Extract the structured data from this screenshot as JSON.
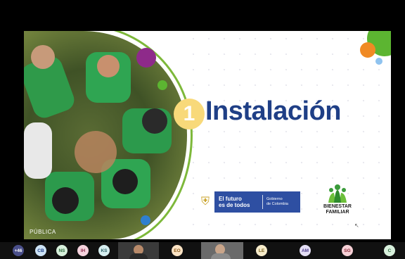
{
  "slide": {
    "number": "1",
    "title": "Instalación",
    "classification": "PÚBLICA",
    "gov_logo": {
      "main_line1": "El futuro",
      "main_line2": "es de todos",
      "sub_line1": "Gobierno",
      "sub_line2": "de Colombia"
    },
    "bf_logo": {
      "line1": "BIENESTAR",
      "line2": "FAMILIAR"
    }
  },
  "participants": [
    {
      "initials": "+46",
      "color": "#4a4f8a",
      "text_color": "#ffffff"
    },
    {
      "initials": "CB",
      "color": "#cde3f6",
      "text_color": "#1f3f86"
    },
    {
      "initials": "NS",
      "color": "#d8f0dc",
      "text_color": "#2d6a3e"
    },
    {
      "initials": "IH",
      "color": "#f6d3de",
      "text_color": "#8a2a4a"
    },
    {
      "initials": "KS",
      "color": "#d6eef0",
      "text_color": "#2b5f66"
    },
    {
      "initials": "EO",
      "color": "#fbe3c4",
      "text_color": "#8a5a1a"
    },
    {
      "initials": "LE",
      "color": "#f7eccb",
      "text_color": "#7a6220"
    },
    {
      "initials": "AM",
      "color": "#e4def4",
      "text_color": "#4a3a8a"
    },
    {
      "initials": "SG",
      "color": "#f6d0d6",
      "text_color": "#8a2a3a"
    },
    {
      "initials": "C",
      "color": "#d8f0dc",
      "text_color": "#2d6a3e"
    }
  ],
  "colors": {
    "title": "#1f3f86",
    "badge": "#f8d97a",
    "purple_dot": "#8e2a8a",
    "green_dot": "#5cb531",
    "orange_dot": "#f08a24",
    "blue_dot": "#2f7fd0"
  }
}
